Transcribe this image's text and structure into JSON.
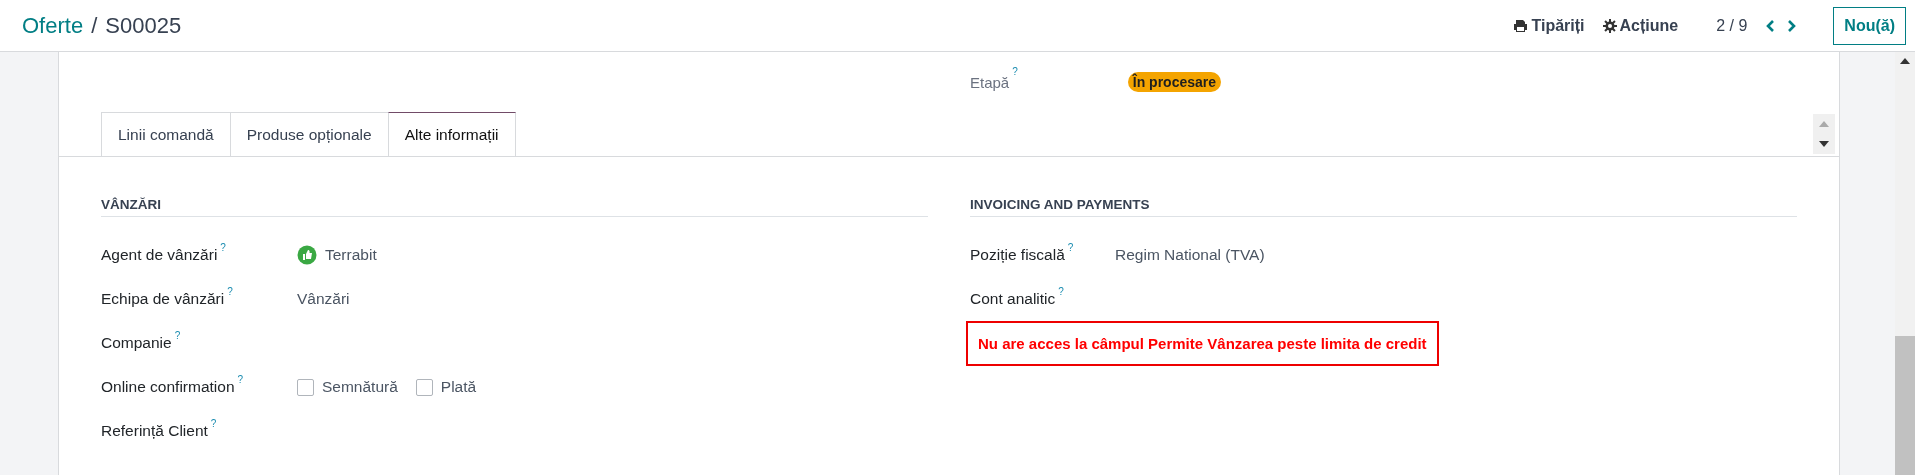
{
  "breadcrumb": {
    "parent": "Oferte",
    "separator": "/",
    "current": "S00025"
  },
  "toolbar": {
    "print": "Tipăriți",
    "action": "Acțiune",
    "pager": "2 / 9",
    "new_button": "Nou(ă)"
  },
  "stage": {
    "label": "Etapă",
    "help": "?",
    "value": "În procesare"
  },
  "tabs": [
    {
      "label": "Linii comandă",
      "selected": false
    },
    {
      "label": "Produse opționale",
      "selected": false
    },
    {
      "label": "Alte informații",
      "selected": true
    }
  ],
  "sections": [
    {
      "title": "VÂNZĂRI",
      "fields": [
        {
          "label": "Agent de vânzări",
          "help": "?",
          "kind": "user",
          "value": "Terrabit"
        },
        {
          "label": "Echipa de vânzări",
          "help": "?",
          "kind": "text",
          "value": "Vânzări"
        },
        {
          "label": "Companie",
          "help": "?",
          "kind": "empty"
        },
        {
          "label": "Online confirmation",
          "help": "?",
          "kind": "checkboxes",
          "options": [
            {
              "label": "Semnătură",
              "checked": false
            },
            {
              "label": "Plată",
              "checked": false
            }
          ]
        },
        {
          "label": "Referință Client",
          "help": "?",
          "kind": "empty"
        }
      ]
    },
    {
      "title": "INVOICING AND PAYMENTS",
      "fields": [
        {
          "label": "Poziție fiscală",
          "help": "?",
          "kind": "text",
          "value": "Regim National (TVA)"
        },
        {
          "label": "Cont analitic",
          "help": "?",
          "kind": "empty"
        },
        {
          "kind": "error",
          "value": "Nu are acces la câmpul Permite Vânzarea peste limita de credit"
        }
      ]
    }
  ]
}
